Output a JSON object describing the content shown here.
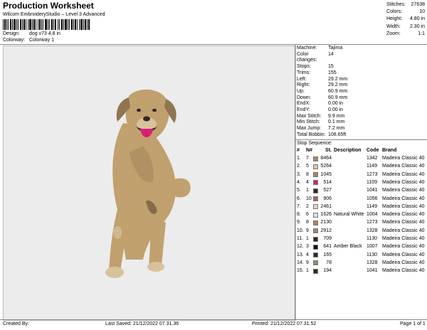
{
  "header": {
    "title": "Production Worksheet",
    "subtitle": "Wilcom EmbroideryStudio – Level 3 Advanced",
    "design_label": "Design:",
    "design_value": "dog v73 4,8 in",
    "colorway_label": "Colorway:",
    "colorway_value": "Colorway 1"
  },
  "stats": [
    {
      "label": "Stitches:",
      "value": "27638"
    },
    {
      "label": "Colors:",
      "value": "10"
    },
    {
      "label": "Height:",
      "value": "4.80 in"
    },
    {
      "label": "Width:",
      "value": "2.30 in"
    },
    {
      "label": "Zoom:",
      "value": "1:1"
    }
  ],
  "specs": [
    {
      "label": "Machine:",
      "value": "Tajima"
    },
    {
      "label": "Color changes:",
      "value": "14"
    },
    {
      "label": "Stops:",
      "value": "15"
    },
    {
      "label": "Trims:",
      "value": "155"
    },
    {
      "label": "Left:",
      "value": "29.2 mm"
    },
    {
      "label": "Right:",
      "value": "29.2 mm"
    },
    {
      "label": "Up:",
      "value": "60.9 mm"
    },
    {
      "label": "Down:",
      "value": "60.9 mm"
    },
    {
      "label": "EndX:",
      "value": "0.00 in"
    },
    {
      "label": "EndY:",
      "value": "0.00 in"
    },
    {
      "label": "Max Stitch:",
      "value": "9.9 mm"
    },
    {
      "label": "Min Stitch:",
      "value": "0.1 mm"
    },
    {
      "label": "Max Jump:",
      "value": "7.2 mm"
    },
    {
      "label": "Total Bobbin:",
      "value": "108.65ft"
    }
  ],
  "stop_sequence": {
    "title": "Stop Sequence:",
    "headers": {
      "num": "#",
      "n": "N#",
      "st": "St.",
      "desc": "Description",
      "code": "Code",
      "brand": "Brand"
    },
    "rows": [
      {
        "num": "1.",
        "n": "7",
        "color": "#a6876b",
        "st": "8464",
        "desc": "",
        "code": "1342",
        "brand": "Madeira Classic 40"
      },
      {
        "num": "2.",
        "n": "5",
        "color": "#dcc6a6",
        "st": "5264",
        "desc": "",
        "code": "1149",
        "brand": "Madeira Classic 40"
      },
      {
        "num": "3.",
        "n": "8",
        "color": "#b2805a",
        "st": "1045",
        "desc": "",
        "code": "1273",
        "brand": "Madeira Classic 40"
      },
      {
        "num": "4.",
        "n": "4",
        "color": "#d9207a",
        "st": "514",
        "desc": "",
        "code": "1109",
        "brand": "Madeira Classic 40"
      },
      {
        "num": "5.",
        "n": "1",
        "color": "#2b2a28",
        "st": "527",
        "desc": "",
        "code": "1041",
        "brand": "Madeira Classic 40"
      },
      {
        "num": "6.",
        "n": "10",
        "color": "#a66a57",
        "st": "906",
        "desc": "",
        "code": "1056",
        "brand": "Madeira Classic 40"
      },
      {
        "num": "7.",
        "n": "2",
        "color": "#e3d3bd",
        "st": "2461",
        "desc": "",
        "code": "1149",
        "brand": "Madeira Classic 40"
      },
      {
        "num": "8.",
        "n": "6",
        "color": "#dde3f0",
        "st": "1626",
        "desc": "Natural White",
        "code": "1004",
        "brand": "Madeira Classic 40"
      },
      {
        "num": "9.",
        "n": "8",
        "color": "#b2805a",
        "st": "2130",
        "desc": "",
        "code": "1273",
        "brand": "Madeira Classic 40"
      },
      {
        "num": "10.",
        "n": "9",
        "color": "#9a8872",
        "st": "2912",
        "desc": "",
        "code": "1328",
        "brand": "Madeira Classic 40"
      },
      {
        "num": "11.",
        "n": "1",
        "color": "#2b2a28",
        "st": "709",
        "desc": "",
        "code": "1130",
        "brand": "Madeira Classic 40"
      },
      {
        "num": "12.",
        "n": "3",
        "color": "#141414",
        "st": "641",
        "desc": "Amber Black",
        "code": "1007",
        "brand": "Madeira Classic 40"
      },
      {
        "num": "13.",
        "n": "4",
        "color": "#2e2a26",
        "st": "165",
        "desc": "",
        "code": "1130",
        "brand": "Madeira Classic 40"
      },
      {
        "num": "14.",
        "n": "9",
        "color": "#9a8872",
        "st": "78",
        "desc": "",
        "code": "1328",
        "brand": "Madeira Classic 40"
      },
      {
        "num": "15.",
        "n": "1",
        "color": "#2b2a28",
        "st": "194",
        "desc": "",
        "code": "1041",
        "brand": "Madeira Classic 40"
      }
    ]
  },
  "footer": {
    "created_by": "Created By:",
    "last_saved": "Last Saved: 21/12/2022 07.31.36",
    "printed": "Printed: 21/12/2022 07.31.52",
    "page": "Page 1 of 1"
  },
  "colors": {
    "canvas_bg": "#ececec",
    "dog_coat": "#c9a874",
    "dog_shadow": "#8f7550",
    "tongue": "#d9207a"
  }
}
